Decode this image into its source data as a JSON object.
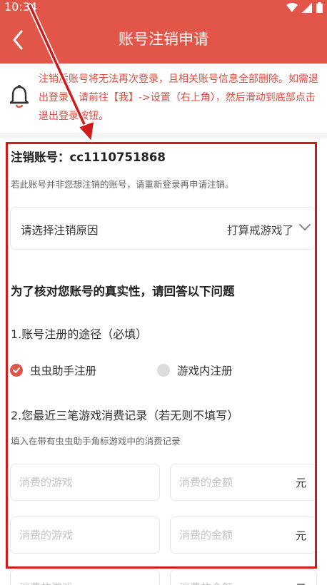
{
  "status_bar": {
    "time": "10:34"
  },
  "header": {
    "title": "账号注销申请"
  },
  "notice": {
    "text": "注销后账号将无法再次登录，且相关账号信息全部删除。如需退出登录，请前往【我】->设置（右上角），然后滑动到底部点击退出登录按钮。"
  },
  "account": {
    "title": "注销账号：cc1110751868",
    "hint": "若此账号并非您想注销的账号，请重新登录再申请注销。"
  },
  "reason": {
    "label": "请选择注销原因",
    "value": "打算戒游戏了"
  },
  "verify": {
    "title": "为了核对您账号的真实性，请回答以下问题",
    "q1": {
      "label": "1.账号注册的途径（必填）",
      "options": [
        {
          "label": "虫虫助手注册",
          "checked": true
        },
        {
          "label": "游戏内注册",
          "checked": false
        }
      ]
    },
    "q2": {
      "label": "2.您最近三笔游戏消费记录（若无则不填写）",
      "hint": "填入在带有虫虫助手角标游戏中的消费记录",
      "game_placeholder": "消费的游戏",
      "amount_placeholder": "消费的金额",
      "unit": "元"
    }
  },
  "colors": {
    "accent": "#e25549",
    "annotation": "#d11a1a"
  },
  "icons": {
    "back": "chevron-left-icon",
    "notice": "bell-icon",
    "select": "chevron-down-icon"
  }
}
